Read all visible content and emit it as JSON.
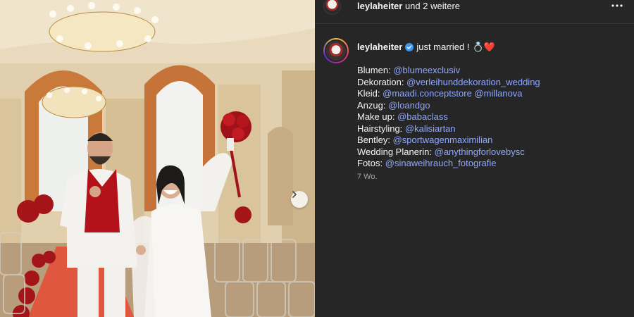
{
  "post": {
    "owner": "leylaheiter",
    "collaborators_text": "und 2 weitere",
    "caption_title": "just married !",
    "caption_emoji": "💍❤️",
    "credits": [
      {
        "label": "Blumen:",
        "mention": "@blumeexclusiv"
      },
      {
        "label": "Dekoration:",
        "mention": "@verleihunddekoration_wedding"
      },
      {
        "label": "Kleid:",
        "mention": "@maadi.conceptstore @millanova"
      },
      {
        "label": "Anzug:",
        "mention": "@loandgo"
      },
      {
        "label": "Make up:",
        "mention": "@babaclass"
      },
      {
        "label": "Hairstyling:",
        "mention": "@kalisiartan"
      },
      {
        "label": "Bentley:",
        "mention": "@sportwagenmaximilian"
      },
      {
        "label": "Wedding Planerin:",
        "mention": "@anythingforlovebysc"
      },
      {
        "label": "Fotos:",
        "mention": "@sinaweihrauch_fotografie"
      }
    ],
    "timestamp": "7 Wo."
  },
  "icons": {
    "more": "more-horizontal-icon",
    "verified": "verified-badge-icon",
    "next": "chevron-right-icon"
  },
  "colors": {
    "panel_bg": "#262626",
    "mention": "#8fa8ff",
    "verified": "#3897f0"
  }
}
